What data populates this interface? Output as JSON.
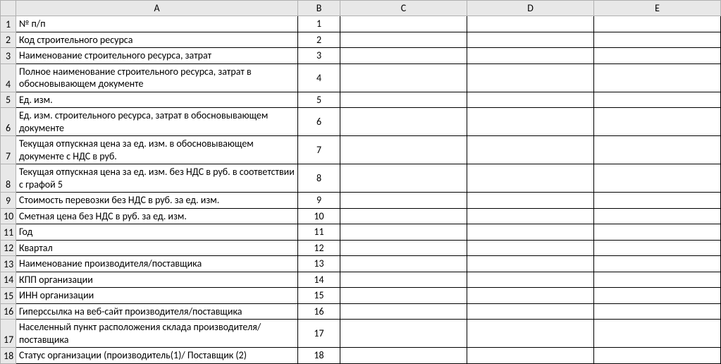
{
  "columns": [
    "A",
    "B",
    "C",
    "D",
    "E"
  ],
  "rows": [
    {
      "num": "1",
      "a": "№ п/п",
      "b": "1"
    },
    {
      "num": "2",
      "a": "Код строительного ресурса",
      "b": "2"
    },
    {
      "num": "3",
      "a": "Наименование строительного ресурса, затрат",
      "b": "3"
    },
    {
      "num": "4",
      "a": "Полное наименование строительного ресурса, затрат в обосновывающем документе",
      "b": "4"
    },
    {
      "num": "5",
      "a": "Ед. изм.",
      "b": "5"
    },
    {
      "num": "6",
      "a": "Ед. изм. строительного ресурса, затрат в обосновывающем документе",
      "b": "6"
    },
    {
      "num": "7",
      "a": "Текущая отпускная цена за ед. изм. в обосновывающем документе с НДС в руб.",
      "b": "7"
    },
    {
      "num": "8",
      "a": "Текущая отпускная цена за ед. изм. без НДС в руб. в соответствии с графой 5",
      "b": "8"
    },
    {
      "num": "9",
      "a": "Стоимость перевозки без НДС в руб. за ед. изм.",
      "b": "9"
    },
    {
      "num": "10",
      "a": "Сметная цена без НДС в руб. за ед. изм.",
      "b": "10"
    },
    {
      "num": "11",
      "a": "Год",
      "b": "11"
    },
    {
      "num": "12",
      "a": "Квартал",
      "b": "12"
    },
    {
      "num": "13",
      "a": "Наименование производителя/поставщика",
      "b": "13"
    },
    {
      "num": "14",
      "a": "КПП организации",
      "b": "14"
    },
    {
      "num": "15",
      "a": "ИНН организации",
      "b": "15"
    },
    {
      "num": "16",
      "a": "Гиперссылка на веб-сайт производителя/поставщика",
      "b": "16"
    },
    {
      "num": "17",
      "a": "Населенный пункт расположения склада производителя/поставщика",
      "b": "17"
    },
    {
      "num": "18",
      "a": "Статус организации (производитель(1)/ Поставщик (2)",
      "b": "18"
    }
  ]
}
